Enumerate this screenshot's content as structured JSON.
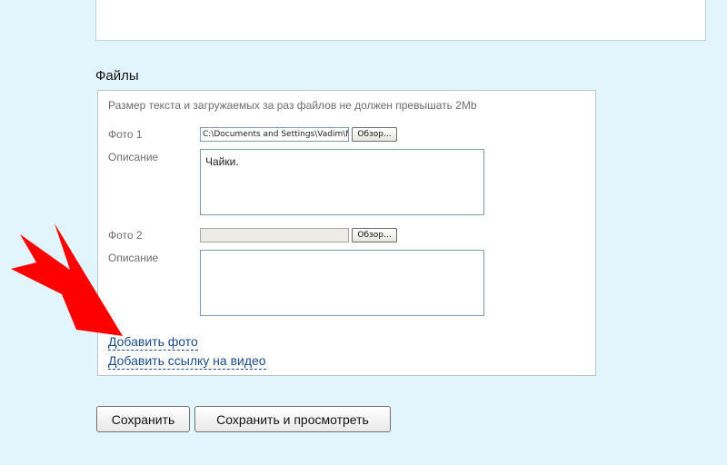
{
  "files_section": {
    "title": "Файлы",
    "limit_note": "Размер текста и загружаемых за раз файлов не должен превышать 2Mb",
    "photos": [
      {
        "label": "Фото 1",
        "file_path": "C:\\Documents and Settings\\Vadim\\Мои",
        "browse_label": "Обзор...",
        "description_label": "Описание",
        "description_value": "Чайки."
      },
      {
        "label": "Фото 2",
        "file_path": "",
        "browse_label": "Обзор...",
        "description_label": "Описание",
        "description_value": ""
      }
    ],
    "add_photo_link": "Добавить фото",
    "add_video_link": "Добавить ссылку на видео"
  },
  "actions": {
    "save_label": "Сохранить",
    "save_preview_label": "Сохранить и просмотреть"
  },
  "colors": {
    "page_background": "#e2f5fc",
    "link": "#1a4b8c",
    "annotation_arrow": "#ff0000"
  }
}
